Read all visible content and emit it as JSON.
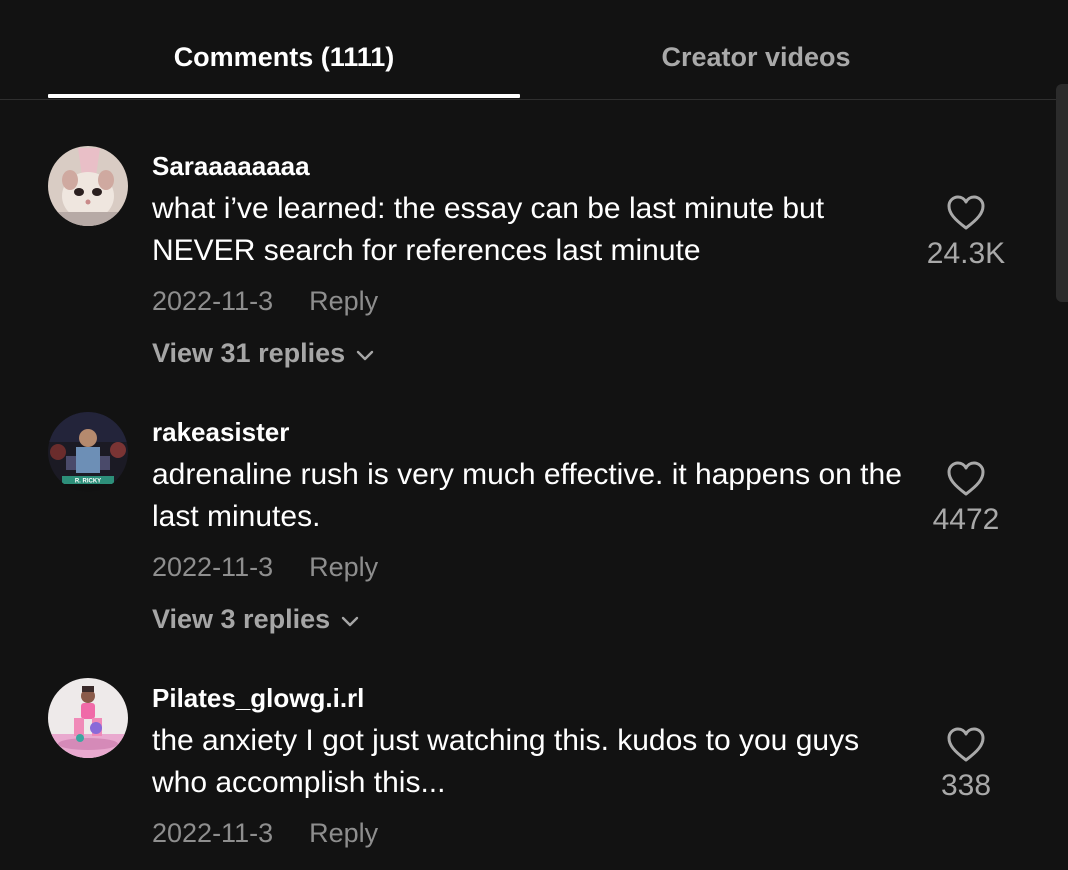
{
  "tabs": {
    "comments_label": "Comments (1111)",
    "videos_label": "Creator videos"
  },
  "comments": [
    {
      "username": "Saraaaaaaaa",
      "text": "what i’ve learned: the essay can be last minute but NEVER search for references last minute",
      "date": "2022-11-3",
      "reply_label": "Reply",
      "likes": "24.3K",
      "view_replies": "View 31 replies",
      "avatar_icon": "cat-photo-avatar"
    },
    {
      "username": "rakeasister",
      "text": "adrenaline rush is very much effective. it happens on the last minutes.",
      "date": "2022-11-3",
      "reply_label": "Reply",
      "likes": "4472",
      "view_replies": "View 3 replies",
      "avatar_icon": "stage-photo-avatar",
      "avatar_caption": "R. RICKY"
    },
    {
      "username": "Pilates_glowg.i.rl",
      "text": "the anxiety I got just watching this. kudos to you guys who accomplish this...",
      "date": "2022-11-3",
      "reply_label": "Reply",
      "likes": "338",
      "avatar_icon": "pilates-photo-avatar"
    }
  ],
  "colors": {
    "background": "#121212",
    "muted_text": "#8e8e8e",
    "active_tab": "#ffffff",
    "inactive_tab": "#a9a9a9"
  }
}
